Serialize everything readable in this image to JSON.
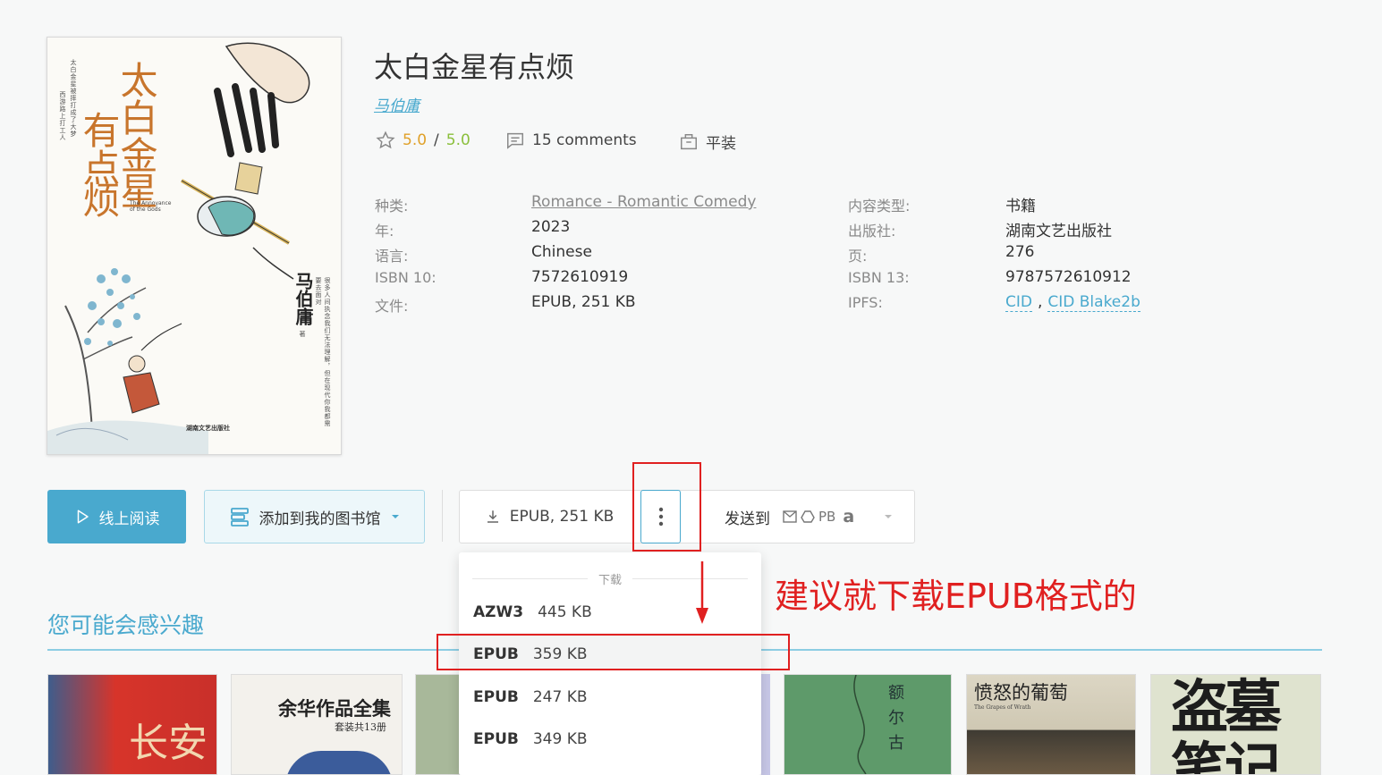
{
  "book": {
    "title": "太白金星有点烦",
    "author": "马伯庸",
    "rating_value": "5.0",
    "rating_sep": "/",
    "rating_max": "5.0",
    "comments": "15 comments",
    "binding": "平装"
  },
  "cover": {
    "title_part1": "太白金",
    "title_part2": "有点",
    "title_part3": "烦",
    "title_part4": "星",
    "author": "马伯庸",
    "author_note": "著",
    "en_title": "The Annoyance of the Gods",
    "blurb1": "太白金星被摔打成了大梦",
    "blurb2": "西游路上打工人",
    "blurb3": "很多人间执念我们无法理解，但在现代你我都需要去面对",
    "publisher_mark": "湖南文艺出版社"
  },
  "properties": {
    "left": [
      {
        "label": "种类:",
        "value": "Romance - Romantic Comedy",
        "link": true
      },
      {
        "label": "年:",
        "value": "2023"
      },
      {
        "label": "语言:",
        "value": "Chinese"
      },
      {
        "label": "ISBN 10:",
        "value": "7572610919"
      },
      {
        "label": "文件:",
        "value": "EPUB, 251 KB"
      }
    ],
    "right": [
      {
        "label": "内容类型:",
        "value": "书籍"
      },
      {
        "label": "出版社:",
        "value": "湖南文艺出版社"
      },
      {
        "label": "页:",
        "value": "276"
      },
      {
        "label": "ISBN 13:",
        "value": "9787572610912"
      },
      {
        "label": "IPFS:",
        "value": ""
      }
    ],
    "ipfs_cid": "CID",
    "ipfs_sep": ",",
    "ipfs_blake": "CID Blake2b"
  },
  "actions": {
    "read_online": "线上阅读",
    "add_to_library": "添加到我的图书馆",
    "download": "EPUB, 251 KB",
    "send_to": "发送到",
    "send_pb": "PB",
    "send_amazon": "a"
  },
  "dropdown": {
    "header": "下载",
    "items": [
      {
        "format": "AZW3",
        "size": "445 KB"
      },
      {
        "format": "EPUB",
        "size": "359 KB"
      },
      {
        "format": "EPUB",
        "size": "247 KB"
      },
      {
        "format": "EPUB",
        "size": "349 KB"
      }
    ]
  },
  "annotation": {
    "text": "建议就下载EPUB格式的",
    "color": "#e02020"
  },
  "recommendations": {
    "title": "您可能会感兴趣",
    "thumbs": [
      {
        "text": "长安"
      },
      {
        "text": "余华作品全集",
        "sub": "套装共13册"
      },
      {
        "text": ""
      },
      {
        "text": "额尔古"
      },
      {
        "text": "愤怒的葡萄",
        "sub": "The Grapes of Wrath"
      },
      {
        "text": "盗墓笔记"
      }
    ]
  },
  "colors": {
    "accent": "#49a9ce",
    "rating": "#e0a12a",
    "rating_max": "#8bbf3c",
    "annotation": "#e02020"
  }
}
